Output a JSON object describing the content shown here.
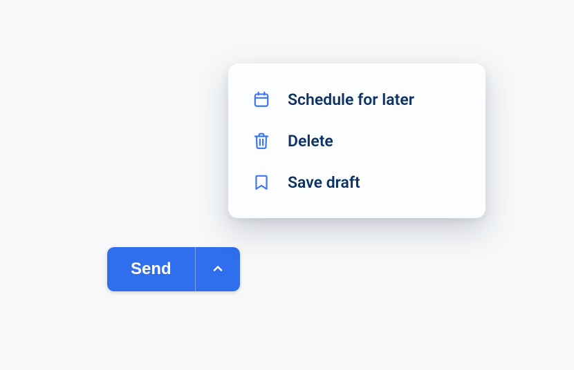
{
  "button": {
    "send_label": "Send"
  },
  "menu": {
    "items": [
      {
        "label": "Schedule for later",
        "icon": "calendar"
      },
      {
        "label": "Delete",
        "icon": "trash"
      },
      {
        "label": "Save draft",
        "icon": "bookmark"
      }
    ]
  },
  "colors": {
    "primary": "#2f6fed",
    "menu_text": "#0d3266",
    "icon": "#3a74ee",
    "background": "#f6f8f9"
  }
}
